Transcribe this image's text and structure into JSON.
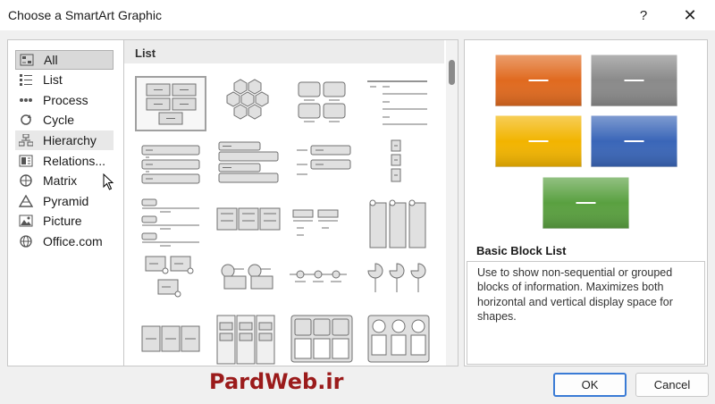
{
  "window": {
    "title": "Choose a SmartArt Graphic",
    "help_glyph": "?",
    "close_glyph": "✕"
  },
  "categories": [
    {
      "label": "All",
      "icon": "all-icon",
      "selected": true
    },
    {
      "label": "List",
      "icon": "list-icon"
    },
    {
      "label": "Process",
      "icon": "process-icon"
    },
    {
      "label": "Cycle",
      "icon": "cycle-icon"
    },
    {
      "label": "Hierarchy",
      "icon": "hierarchy-icon",
      "hovered": true
    },
    {
      "label": "Relations...",
      "icon": "relationship-icon"
    },
    {
      "label": "Matrix",
      "icon": "matrix-icon"
    },
    {
      "label": "Pyramid",
      "icon": "pyramid-icon"
    },
    {
      "label": "Picture",
      "icon": "picture-icon"
    },
    {
      "label": "Office.com",
      "icon": "globe-icon"
    }
  ],
  "gallery": {
    "title": "List"
  },
  "preview": {
    "name": "Basic Block List",
    "description": "Use to show non-sequential or grouped blocks of information. Maximizes both horizontal and vertical display space for shapes.",
    "colors": [
      "#e06a1f",
      "#8a8a8a",
      "#f2b400",
      "#3a66b8",
      "#5aa040"
    ]
  },
  "footer": {
    "brand": "PardWeb.ir",
    "ok_label": "OK",
    "cancel_label": "Cancel"
  },
  "colors": {
    "accent": "#3a7bd5",
    "brand": "#9b1b1b"
  }
}
